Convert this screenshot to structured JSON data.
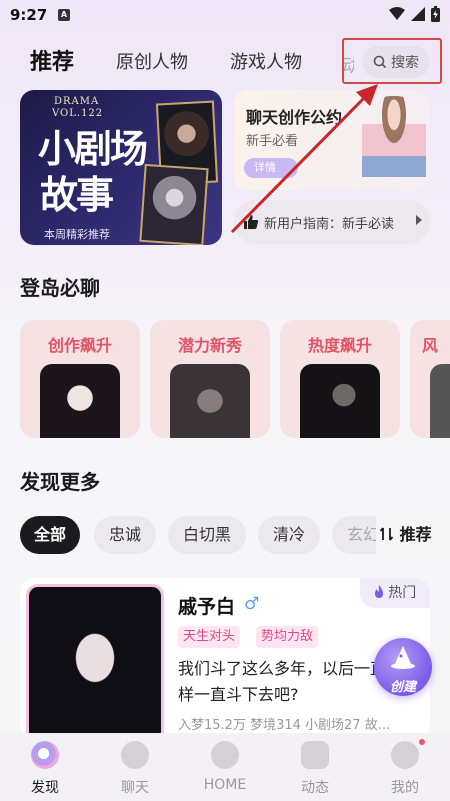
{
  "status": {
    "time": "9:27",
    "notif": "A"
  },
  "top_tabs": [
    {
      "label": "推荐",
      "active": true
    },
    {
      "label": "原创人物",
      "active": false
    },
    {
      "label": "游戏人物",
      "active": false
    },
    {
      "label": "动",
      "active": false
    }
  ],
  "search": {
    "label": "搜索"
  },
  "banner": {
    "drama": "DRAMA",
    "vol": "VOL.122",
    "title_line1": "小剧场",
    "title_line2": "故事",
    "subtitle": "本周精彩推荐"
  },
  "chat_card": {
    "title": "聊天创作公约",
    "subtitle": "新手必看",
    "detail_label": "详情"
  },
  "guide": {
    "text": "新用户指南：新手必读"
  },
  "sections": {
    "login": "登岛必聊",
    "discover": "发现更多"
  },
  "categories": [
    {
      "title": "创作飙升"
    },
    {
      "title": "潜力新秀"
    },
    {
      "title": "热度飙升"
    },
    {
      "title": "风"
    }
  ],
  "chips": [
    {
      "label": "全部",
      "active": true
    },
    {
      "label": "忠诚",
      "active": false
    },
    {
      "label": "白切黑",
      "active": false
    },
    {
      "label": "清冷",
      "active": false
    },
    {
      "label": "玄幻",
      "active": false
    }
  ],
  "sort": {
    "label": "推荐"
  },
  "character": {
    "name": "戚予白",
    "gender_symbol": "♂",
    "hot_label": "热门",
    "tags": [
      "天生对头",
      "势均力敌"
    ],
    "description": "我们斗了这么多年，以后一直这样一直斗下去吧?",
    "stats": "入梦15.2万  梦境314  小剧场27  故..."
  },
  "fab": {
    "label": "创建"
  },
  "nav": [
    {
      "label": "发现",
      "active": true
    },
    {
      "label": "聊天",
      "active": false
    },
    {
      "label": "HOME",
      "active": false
    },
    {
      "label": "动态",
      "active": false
    },
    {
      "label": "我的",
      "active": false
    }
  ],
  "colors": {
    "accent": "#e05468",
    "brand_purple": "#7a5ce8",
    "annotation_red": "#d04a4a"
  }
}
